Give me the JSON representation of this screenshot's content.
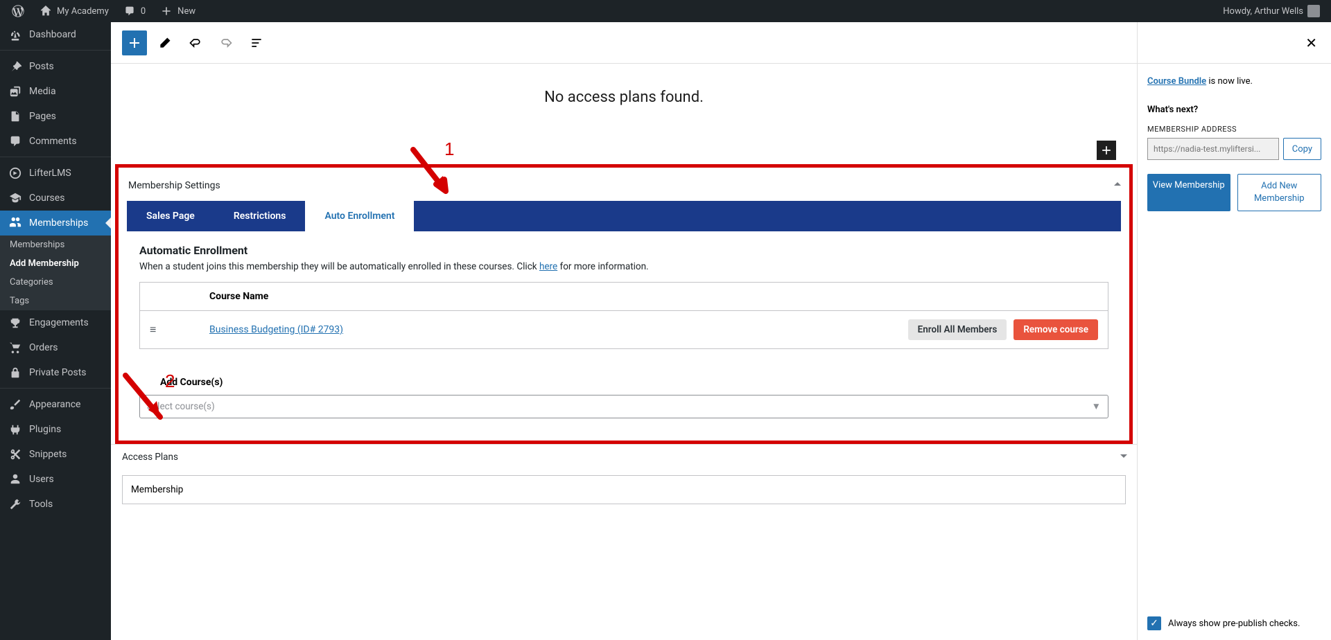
{
  "adminbar": {
    "site_name": "My Academy",
    "comments_count": "0",
    "new_label": "New",
    "greeting": "Howdy, Arthur Wells"
  },
  "sidebar": {
    "dashboard": "Dashboard",
    "posts": "Posts",
    "media": "Media",
    "pages": "Pages",
    "comments": "Comments",
    "lifterlms": "LifterLMS",
    "courses": "Courses",
    "memberships": "Memberships",
    "sub_memberships": "Memberships",
    "sub_add_membership": "Add Membership",
    "sub_categories": "Categories",
    "sub_tags": "Tags",
    "engagements": "Engagements",
    "orders": "Orders",
    "private_posts": "Private Posts",
    "appearance": "Appearance",
    "plugins": "Plugins",
    "snippets": "Snippets",
    "users": "Users",
    "tools": "Tools"
  },
  "editor": {
    "no_access_plans": "No access plans found."
  },
  "membership_settings": {
    "title": "Membership Settings",
    "tabs": {
      "sales_page": "Sales Page",
      "restrictions": "Restrictions",
      "auto_enrollment": "Auto Enrollment"
    },
    "auto_enroll": {
      "title": "Automatic Enrollment",
      "desc_pre": "When a student joins this membership they will be automatically enrolled in these courses. Click ",
      "desc_link": "here",
      "desc_post": " for more information.",
      "col_name": "Course Name",
      "row_course": "Business Budgeting (ID# 2793)",
      "enroll_all": "Enroll All Members",
      "remove": "Remove course",
      "add_label": "Add Course(s)",
      "select_placeholder": "Select course(s)"
    }
  },
  "access_plans": {
    "title": "Access Plans",
    "membership": "Membership"
  },
  "publish": {
    "bundle_link": "Course Bundle",
    "live_text": " is now live.",
    "whats_next": "What's next?",
    "address_label": "MEMBERSHIP ADDRESS",
    "address_value": "https://nadia-test.myliftersi...",
    "copy": "Copy",
    "view": "View Membership",
    "add_new": "Add New Membership",
    "always_show": "Always show pre-publish checks."
  },
  "annotations": {
    "one": "1",
    "two": "2"
  }
}
